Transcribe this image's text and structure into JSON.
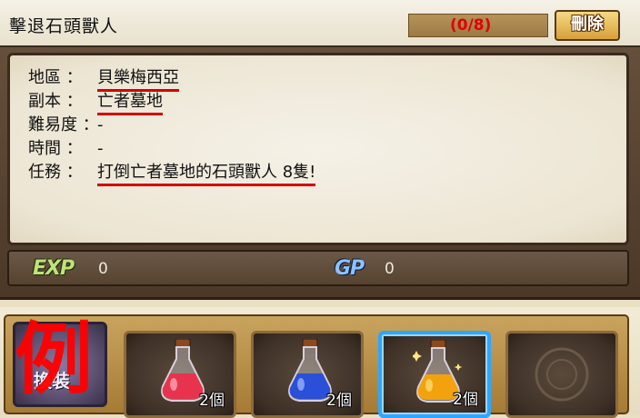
{
  "quest": {
    "title": "擊退石頭獸人",
    "progress": "(0/8)",
    "delete_label": "刪除"
  },
  "info": {
    "region_label": "地區 ：",
    "region_value": "貝樂梅西亞",
    "instance_label": "副本 ：",
    "instance_value": "亡者墓地",
    "difficulty_label": "難易度 ：",
    "difficulty_value": "-",
    "time_label": "時間 ：",
    "time_value": "-",
    "mission_label": "任務 ：",
    "mission_value": "打倒亡者墓地的石頭獸人 8隻!"
  },
  "rewards": {
    "exp_label": "EXP",
    "exp_value": "0",
    "gp_label": "GP",
    "gp_value": "0"
  },
  "inventory": {
    "side_button_label": "換裝",
    "example_mark": "例",
    "slots": [
      {
        "item": "red-potion-icon",
        "count": "2個"
      },
      {
        "item": "blue-potion-icon",
        "count": "2個"
      },
      {
        "item": "yellow-potion-icon",
        "count": "2個",
        "selected": true
      },
      {
        "item": "empty",
        "count": ""
      }
    ]
  },
  "colors": {
    "underline": "#d40000",
    "progress_text": "#e10000",
    "exp": "#bfe27a",
    "gp": "#8fc0ff",
    "selected_slot": "#2ea6ff",
    "red_potion": "#e8334f",
    "blue_potion": "#2a4fd8",
    "yellow_potion": "#f2a20c"
  }
}
